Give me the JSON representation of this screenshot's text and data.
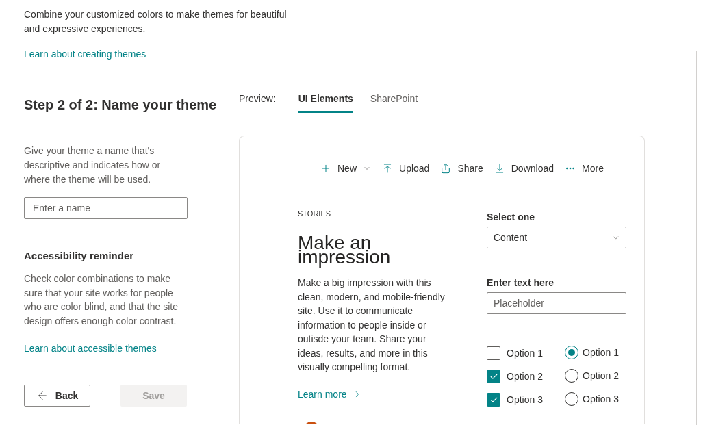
{
  "intro": {
    "text": "Combine your customized colors to make themes for beautiful and expressive experiences.",
    "link": "Learn about creating themes"
  },
  "step": {
    "title": "Step 2 of 2: Name your theme",
    "description": "Give your theme a name that's descriptive and indicates how or where the theme will be used.",
    "name_field": {
      "placeholder": "Enter a name"
    }
  },
  "accessibility": {
    "title": "Accessibility reminder",
    "text": "Check color combinations to make sure that your site works for people who are color blind, and that the site design offers enough color contrast.",
    "link": "Learn about accessible themes"
  },
  "buttons": [
    {
      "label": "Back",
      "kind": "back",
      "disabled": false
    },
    {
      "label": "Save",
      "kind": "save",
      "disabled": true
    }
  ],
  "preview": {
    "label": "Preview:",
    "tabs": [
      {
        "label": "UI Elements",
        "selected": true
      },
      {
        "label": "SharePoint",
        "selected": false
      }
    ]
  },
  "toolbar": [
    {
      "label": "New",
      "kind": "new"
    },
    {
      "label": "Upload",
      "kind": "upload"
    },
    {
      "label": "Share",
      "kind": "share"
    },
    {
      "label": "Download",
      "kind": "download"
    },
    {
      "label": "More",
      "kind": "more"
    }
  ],
  "story": {
    "eyebrow": "STORIES",
    "headline": "Make an impression",
    "body": "Make a big impression with this clean, modern, and mobile-friendly site. Use it to communicate information to people inside or outisde your team. Share your ideas, results, and more in this visually compelling format.",
    "link": "Learn more"
  },
  "form": {
    "select": {
      "label": "Select one",
      "value": "Content"
    },
    "text_field": {
      "label": "Enter text here",
      "placeholder": "Placeholder"
    },
    "checkboxes": [
      {
        "label": "Option 1",
        "checked": false
      },
      {
        "label": "Option 2",
        "checked": true
      },
      {
        "label": "Option 3",
        "checked": true
      }
    ],
    "radios": [
      {
        "label": "Option 1",
        "selected": true
      },
      {
        "label": "Option 2",
        "selected": false
      },
      {
        "label": "Option 3",
        "selected": false
      }
    ]
  }
}
